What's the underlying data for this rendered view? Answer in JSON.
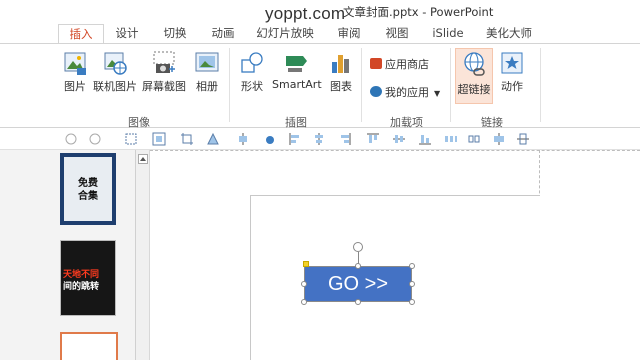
{
  "title_bar": {
    "watermark": "yoppt.com",
    "document_title": "文章封面.pptx - PowerPoint"
  },
  "tabs": [
    "插入",
    "设计",
    "切换",
    "动画",
    "幻灯片放映",
    "审阅",
    "视图",
    "iSlide",
    "美化大师"
  ],
  "active_tab": "插入",
  "ribbon": {
    "images_group": {
      "label": "图像",
      "buttons": [
        "图片",
        "联机图片",
        "屏幕截图",
        "相册"
      ]
    },
    "illustrations_group": {
      "label": "插图",
      "buttons": [
        "形状",
        "SmartArt",
        "图表"
      ]
    },
    "addins_group": {
      "label": "加载项",
      "buttons": [
        "应用商店",
        "我的应用"
      ]
    },
    "links_group": {
      "label": "链接",
      "buttons": [
        "超链接",
        "动作"
      ]
    }
  },
  "thumbnails": {
    "slide1_text_line1": "免费",
    "slide1_text_line2": "合集",
    "slide2_text_line1": "天地不同",
    "slide2_text_line2": "间的跳转"
  },
  "canvas": {
    "button_text": "GO >>"
  },
  "colors": {
    "accent": "#d24726",
    "button_fill": "#4472c4",
    "hyperlink_highlight": "#fbe4d8"
  }
}
